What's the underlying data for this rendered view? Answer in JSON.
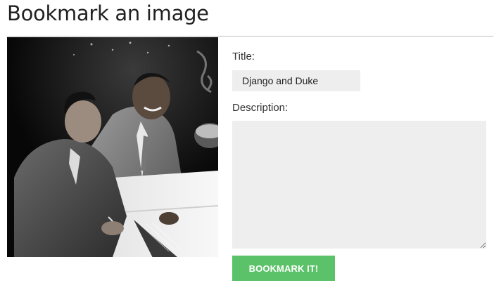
{
  "header": {
    "title": "Bookmark an image"
  },
  "image": {
    "description": "black-and-white photo of two men at a piano"
  },
  "form": {
    "title_label": "Title:",
    "title_value": "Django and Duke",
    "description_label": "Description:",
    "description_value": "",
    "submit_label": "BOOKMARK IT!"
  },
  "colors": {
    "button_bg": "#5cc26a",
    "input_bg": "#eeeeee",
    "divider": "#bdbdbd"
  }
}
